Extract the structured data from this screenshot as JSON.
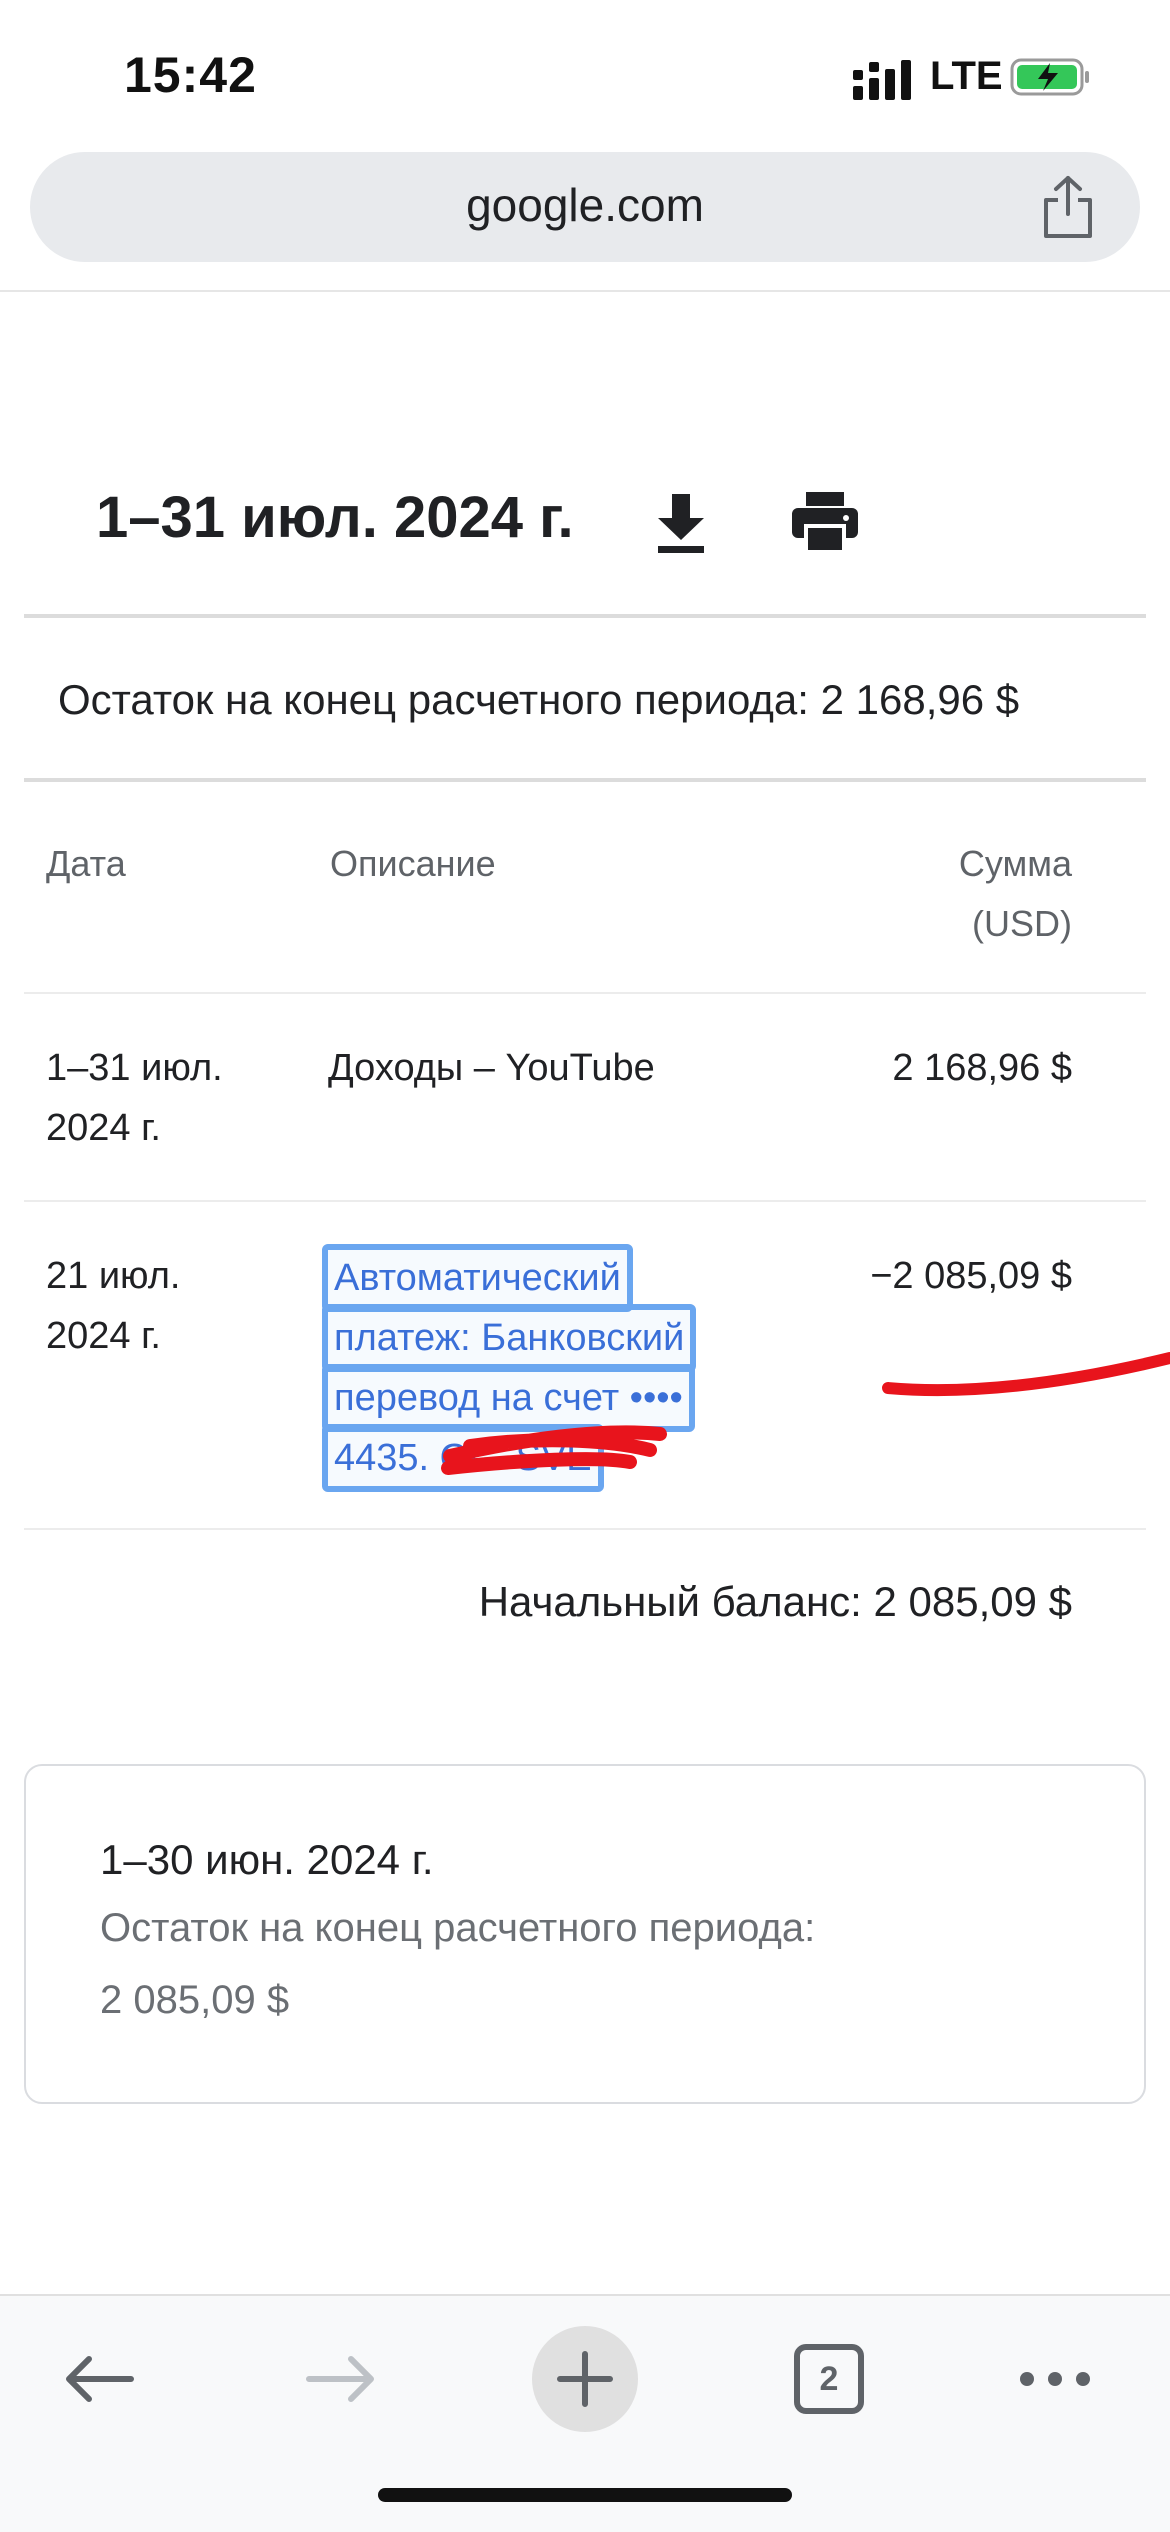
{
  "status_bar": {
    "time": "15:42",
    "network": "LTE"
  },
  "browser": {
    "url": "google.com",
    "tab_count": "2"
  },
  "statement": {
    "period": "1–31 июл. 2024 г.",
    "ending_balance": "Остаток на конец расчетного периода: 2 168,96 $",
    "columns": {
      "date": "Дата",
      "description": "Описание",
      "amount_line1": "Сумма",
      "amount_line2": "(USD)"
    },
    "rows": [
      {
        "date_line1": "1–31 июл.",
        "date_line2": "2024 г.",
        "description": "Доходы – YouTube",
        "amount": "2 168,96 $"
      },
      {
        "date_line1": "21 июл.",
        "date_line2": "2024 г.",
        "description_lines": [
          "Автоматический",
          "платеж: Банковский",
          "перевод на счет  ••••",
          "4435. C··· SVE"
        ],
        "amount": "−2 085,09 $"
      }
    ],
    "opening_balance": "Начальный баланс: 2 085,09 $"
  },
  "previous_period": {
    "period": "1–30 июн. 2024 г.",
    "label": "Остаток на конец расчетного периода:",
    "value": "2 085,09 $"
  },
  "colors": {
    "link": "#3a6fd8",
    "highlight": "#6aa6f0",
    "scribble": "#e8141c",
    "battery": "#34c759"
  }
}
